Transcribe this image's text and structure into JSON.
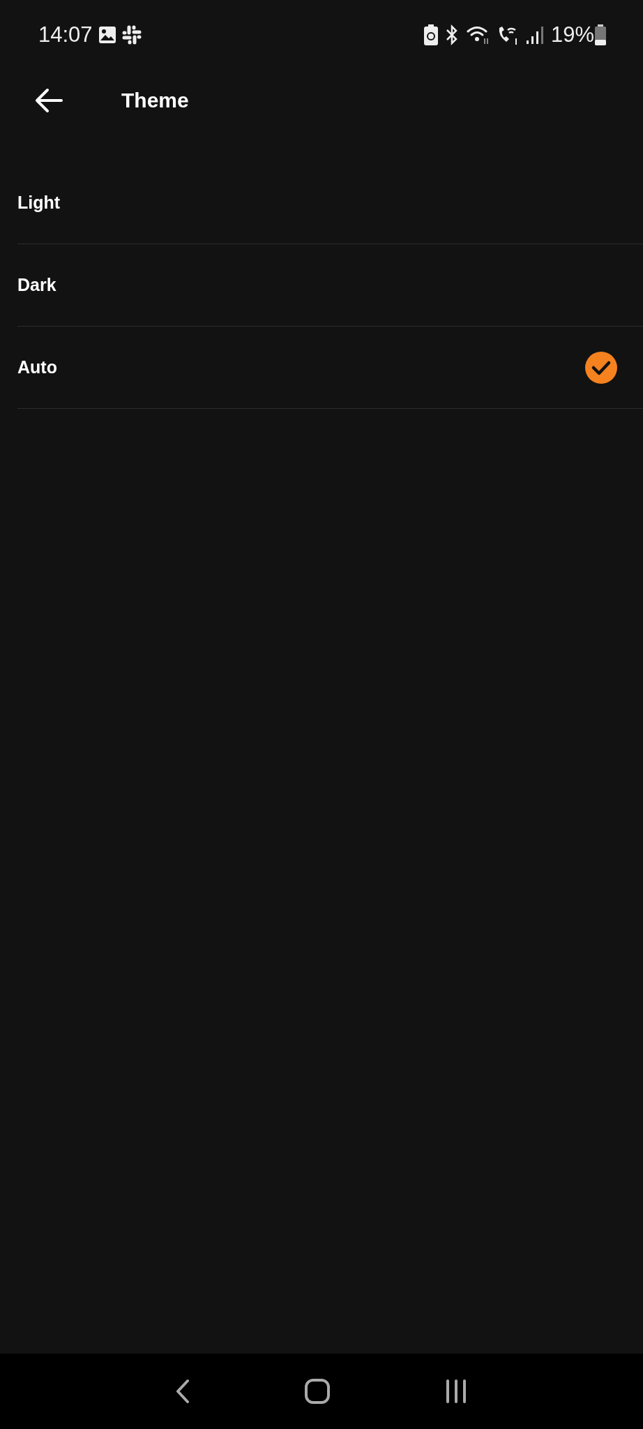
{
  "status_bar": {
    "time": "14:07",
    "battery_percent": "19%"
  },
  "header": {
    "title": "Theme"
  },
  "options": [
    {
      "label": "Light",
      "selected": false
    },
    {
      "label": "Dark",
      "selected": false
    },
    {
      "label": "Auto",
      "selected": true
    }
  ]
}
